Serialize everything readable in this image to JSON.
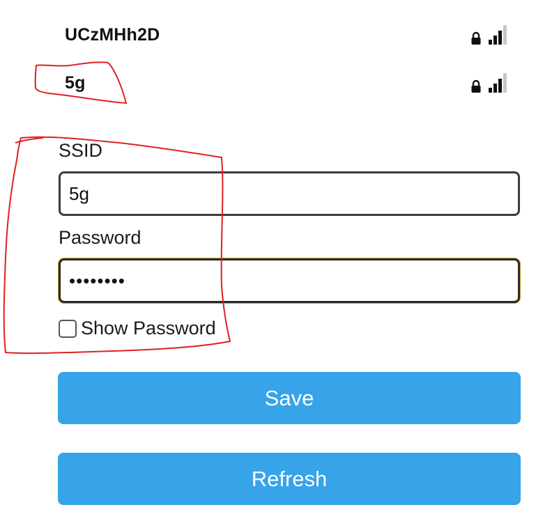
{
  "networks": [
    {
      "name": "UCzMHh2D",
      "icons": [
        "lock-icon",
        "signal-icon"
      ],
      "signal_level": 3,
      "signal_max": 4
    },
    {
      "name": "5g",
      "icons": [
        "lock-icon",
        "signal-icon"
      ],
      "signal_level": 3,
      "signal_max": 4
    }
  ],
  "form": {
    "ssid_label": "SSID",
    "ssid_value": "5g",
    "password_label": "Password",
    "password_value": "••••••••",
    "show_password_label": "Show Password",
    "show_password_checked": false
  },
  "buttons": {
    "save_label": "Save",
    "refresh_label": "Refresh"
  },
  "colors": {
    "button": "#37a3e8",
    "annotation": "#e02020",
    "focus_border": "#c9a227"
  }
}
